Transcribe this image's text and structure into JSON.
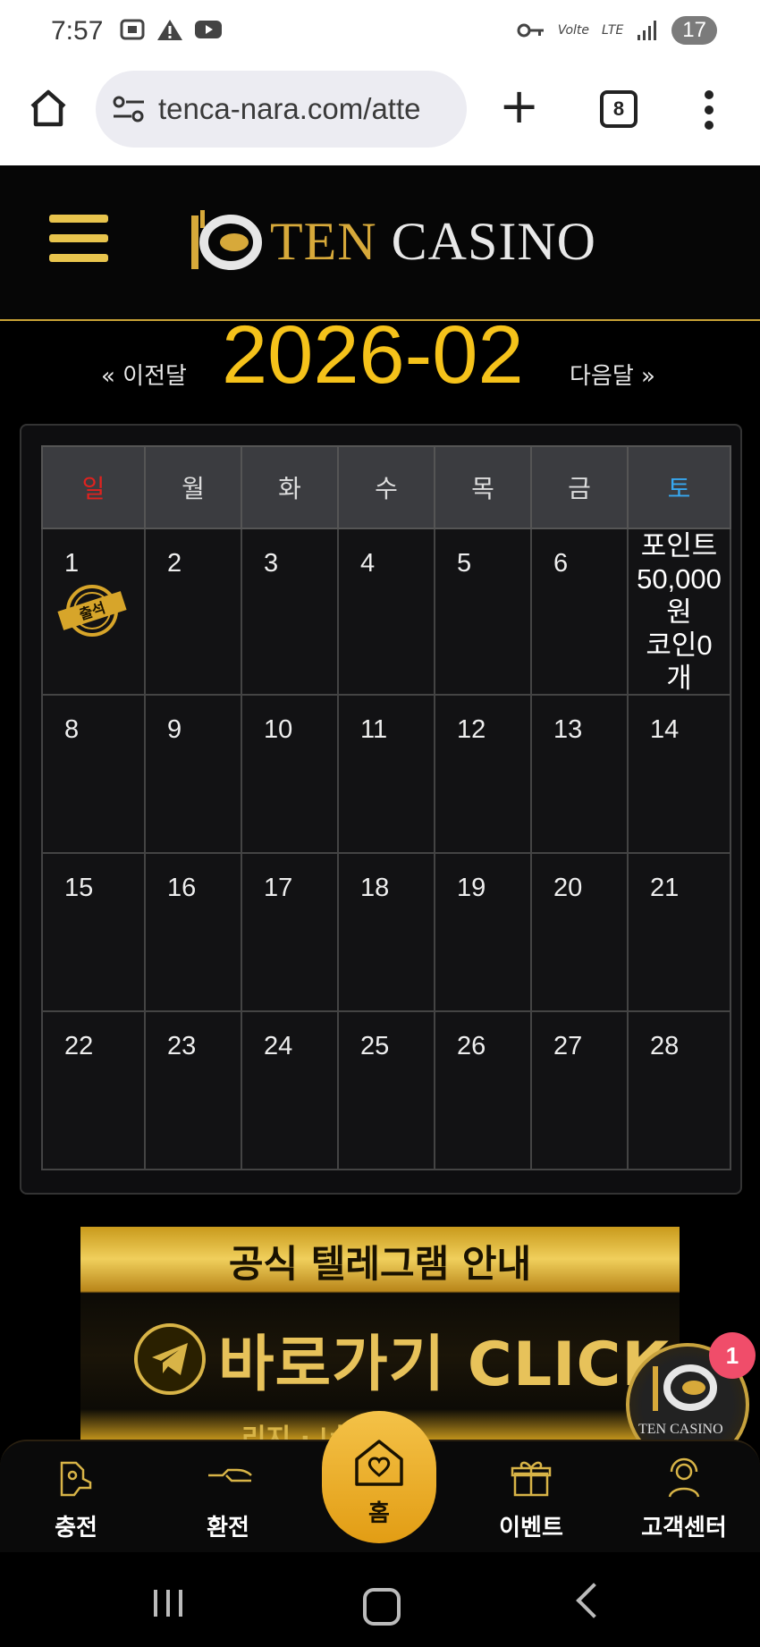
{
  "status_bar": {
    "time": "7:57",
    "network": "Volte",
    "lte": "LTE",
    "battery": "17"
  },
  "browser": {
    "url": "tenca-nara.com/atte",
    "tab_count": "8"
  },
  "site": {
    "logo_ten": "TEN",
    "logo_casino": "CASINO"
  },
  "calendar": {
    "prev_label": "« 이전달",
    "next_label": "다음달 »",
    "month_title": "2026-02",
    "weekdays": [
      "일",
      "월",
      "화",
      "수",
      "목",
      "금",
      "토"
    ],
    "week1": [
      "1",
      "2",
      "3",
      "4",
      "5",
      "6"
    ],
    "attendance_stamp": "출석",
    "sat_info": [
      "포인트",
      "50,000",
      "원",
      "코인0",
      "개"
    ],
    "week2": [
      "8",
      "9",
      "10",
      "11",
      "12",
      "13",
      "14"
    ],
    "week3": [
      "15",
      "16",
      "17",
      "18",
      "19",
      "20",
      "21"
    ],
    "week4": [
      "22",
      "23",
      "24",
      "25",
      "26",
      "27",
      "28"
    ]
  },
  "banner": {
    "top_text": "공식 텔레그램 안내",
    "main_text": "바로가기 CLICK",
    "bottom_text": "리지 ·   너모집"
  },
  "floating": {
    "logo_text": "TEN CASINO",
    "badge": "1"
  },
  "bottom_nav": {
    "charge": "충전",
    "exchange": "환전",
    "home": "홈",
    "event": "이벤트",
    "support": "고객센터"
  }
}
